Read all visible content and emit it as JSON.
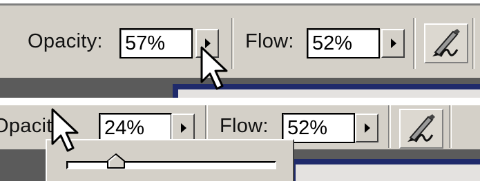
{
  "panels": [
    {
      "opacity_label": "Opacity:",
      "opacity_value": "57%",
      "flow_label": "Flow:",
      "flow_value": "52%"
    },
    {
      "opacity_label": "Opacity:",
      "opacity_value": "24%",
      "flow_label": "Flow:",
      "flow_value": "52%",
      "slider_level_percent": 24
    }
  ],
  "icons": {
    "airbrush": "airbrush-icon",
    "dropdown": "triangle-right-icon",
    "cursor": "arrow-cursor-icon",
    "slider_thumb": "slider-thumb-icon"
  },
  "colors": {
    "toolbar": "#d4d0c8",
    "document_area": "#5b5b5b",
    "canvas_border": "#1f2a6b"
  }
}
